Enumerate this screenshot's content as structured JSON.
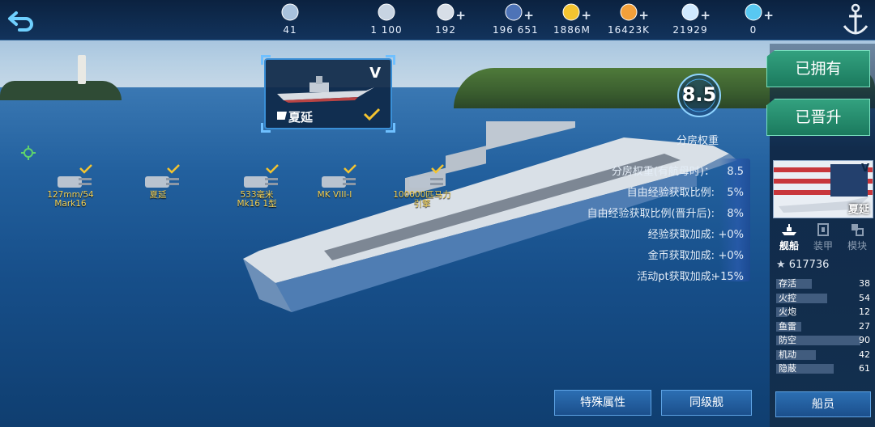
{
  "resources": [
    {
      "icon": "rank-badge-icon",
      "value": "41",
      "plus": false
    },
    {
      "icon": "silver-coin-icon",
      "value": "1 100",
      "plus": false
    },
    {
      "icon": "heart-icon",
      "value": "192",
      "plus": true
    },
    {
      "icon": "card-icon",
      "value": "196 651",
      "plus": true
    },
    {
      "icon": "gold-coin-icon",
      "value": "1886M",
      "plus": true
    },
    {
      "icon": "star-icon",
      "value": "16423K",
      "plus": true
    },
    {
      "icon": "diamond-icon",
      "value": "21929",
      "plus": true
    },
    {
      "icon": "crystal-icon",
      "value": "0",
      "plus": true
    }
  ],
  "ship_card": {
    "tier": "V",
    "name": "夏延"
  },
  "score": {
    "value": "8.5",
    "label": "分房权重"
  },
  "equipment": [
    {
      "label_line1": "127mm/54",
      "label_line2": "Mark16"
    },
    {
      "label_line1": "夏延",
      "label_line2": ""
    },
    {
      "label_line1": "533毫米",
      "label_line2": "Mk16 1型"
    },
    {
      "label_line1": "MK VIII-I",
      "label_line2": ""
    },
    {
      "label_line1": "100000匹马力",
      "label_line2": "引擎"
    }
  ],
  "bonuses": [
    {
      "label": "分房权重(有航母时)：",
      "value": "8.5"
    },
    {
      "label": "自由经验获取比例:",
      "value": "5%"
    },
    {
      "label": "自由经验获取比例(晋升后):",
      "value": "8%"
    },
    {
      "label": "经验获取加成:",
      "value": "+0%"
    },
    {
      "label": "金币获取加成:",
      "value": "+0%"
    },
    {
      "label": "活动pt获取加成:",
      "value": "+15%"
    }
  ],
  "buttons": {
    "special": "特殊属性",
    "same_tier": "同级舰",
    "owned": "已拥有",
    "promoted": "已晋升",
    "crew": "船员"
  },
  "side_card": {
    "tier": "V",
    "name": "夏延"
  },
  "tabs": [
    {
      "label": "舰船",
      "icon": "ship-icon"
    },
    {
      "label": "装甲",
      "icon": "armor-icon"
    },
    {
      "label": "模块",
      "icon": "module-icon"
    }
  ],
  "experience": "617736",
  "attributes": [
    {
      "label": "存活",
      "value": 38
    },
    {
      "label": "火控",
      "value": 54
    },
    {
      "label": "火炮",
      "value": 12
    },
    {
      "label": "鱼雷",
      "value": 27
    },
    {
      "label": "防空",
      "value": 90
    },
    {
      "label": "机动",
      "value": 42
    },
    {
      "label": "隐蔽",
      "value": 61
    }
  ],
  "colors": {
    "accent_green": "#2f9a77",
    "panel_blue": "#1b4f8c",
    "equip_label": "#f6d55a"
  }
}
